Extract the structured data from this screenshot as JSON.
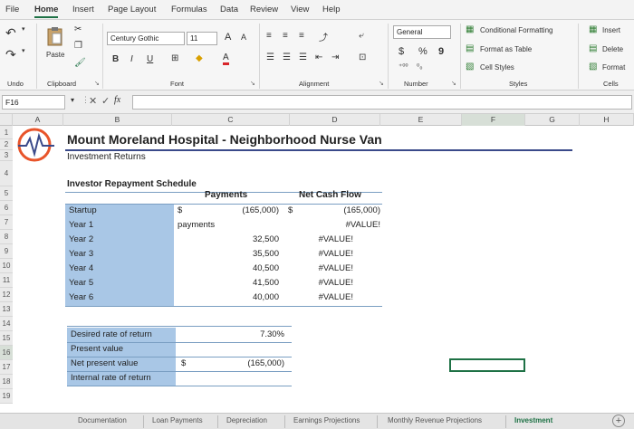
{
  "menu": [
    "File",
    "Home",
    "Insert",
    "Page Layout",
    "Formulas",
    "Data",
    "Review",
    "View",
    "Help"
  ],
  "ribbon": {
    "undo_label": "Undo",
    "clipboard_label": "Clipboard",
    "paste_label": "Paste",
    "font_label": "Font",
    "font_name": "Century Gothic",
    "font_size": "11",
    "bold": "B",
    "italic": "I",
    "underline": "U",
    "grow_font": "A",
    "shrink_font": "A",
    "font_color": "A",
    "alignment_label": "Alignment",
    "number_label": "Number",
    "number_format": "General",
    "currency": "$",
    "percent": "%",
    "comma": "9",
    "styles_label": "Styles",
    "conditional_formatting": "Conditional Formatting",
    "format_as_table": "Format as Table",
    "cell_styles": "Cell Styles",
    "cells_label": "Cells",
    "insert": "Insert",
    "delete": "Delete",
    "format": "Format"
  },
  "formula_bar": {
    "name_box": "F16",
    "fx": "fx",
    "cancel": "✕",
    "enter": "✓"
  },
  "columns": [
    "A",
    "B",
    "C",
    "D",
    "E",
    "F",
    "G",
    "H"
  ],
  "rows": [
    "1",
    "2",
    "3",
    "4",
    "5",
    "6",
    "7",
    "8",
    "9",
    "10",
    "11",
    "12",
    "13",
    "14",
    "15",
    "16",
    "17",
    "18",
    "19"
  ],
  "sheet": {
    "title": "Mount Moreland Hospital - Neighborhood Nurse Van",
    "subtitle": "Investment Returns",
    "section_title": "Investor Repayment Schedule",
    "payments_header": "Payments",
    "net_cash_header": "Net Cash Flow",
    "schedule": [
      {
        "label": "Startup",
        "currency": "$",
        "payment": "(165,000)",
        "net_currency": "$",
        "net": "(165,000)"
      },
      {
        "label": "Year 1",
        "currency": "payments",
        "payment": "",
        "net_currency": "",
        "net": "#VALUE!"
      },
      {
        "label": "Year 2",
        "currency": "",
        "payment": "32,500",
        "net_currency": "",
        "net": "#VALUE!"
      },
      {
        "label": "Year 3",
        "currency": "",
        "payment": "35,500",
        "net_currency": "",
        "net": "#VALUE!"
      },
      {
        "label": "Year 4",
        "currency": "",
        "payment": "40,500",
        "net_currency": "",
        "net": "#VALUE!"
      },
      {
        "label": "Year 5",
        "currency": "",
        "payment": "41,500",
        "net_currency": "",
        "net": "#VALUE!"
      },
      {
        "label": "Year 6",
        "currency": "",
        "payment": "40,000",
        "net_currency": "",
        "net": "#VALUE!"
      }
    ],
    "summary": [
      {
        "label": "Desired rate of return",
        "currency": "",
        "value": "7.30%"
      },
      {
        "label": "Present value",
        "currency": "",
        "value": ""
      },
      {
        "label": "Net present value",
        "currency": "$",
        "value": "(165,000)"
      },
      {
        "label": "Internal rate of return",
        "currency": "",
        "value": ""
      }
    ]
  },
  "tabs": [
    "Documentation",
    "Loan Payments",
    "Depreciation",
    "Earnings Projections",
    "Monthly Revenue Projections",
    "Investment"
  ],
  "add_sheet": "+",
  "colors": {
    "accent": "#1e7145",
    "logo": "#e8542a",
    "highlight": "#a9c7e6"
  }
}
